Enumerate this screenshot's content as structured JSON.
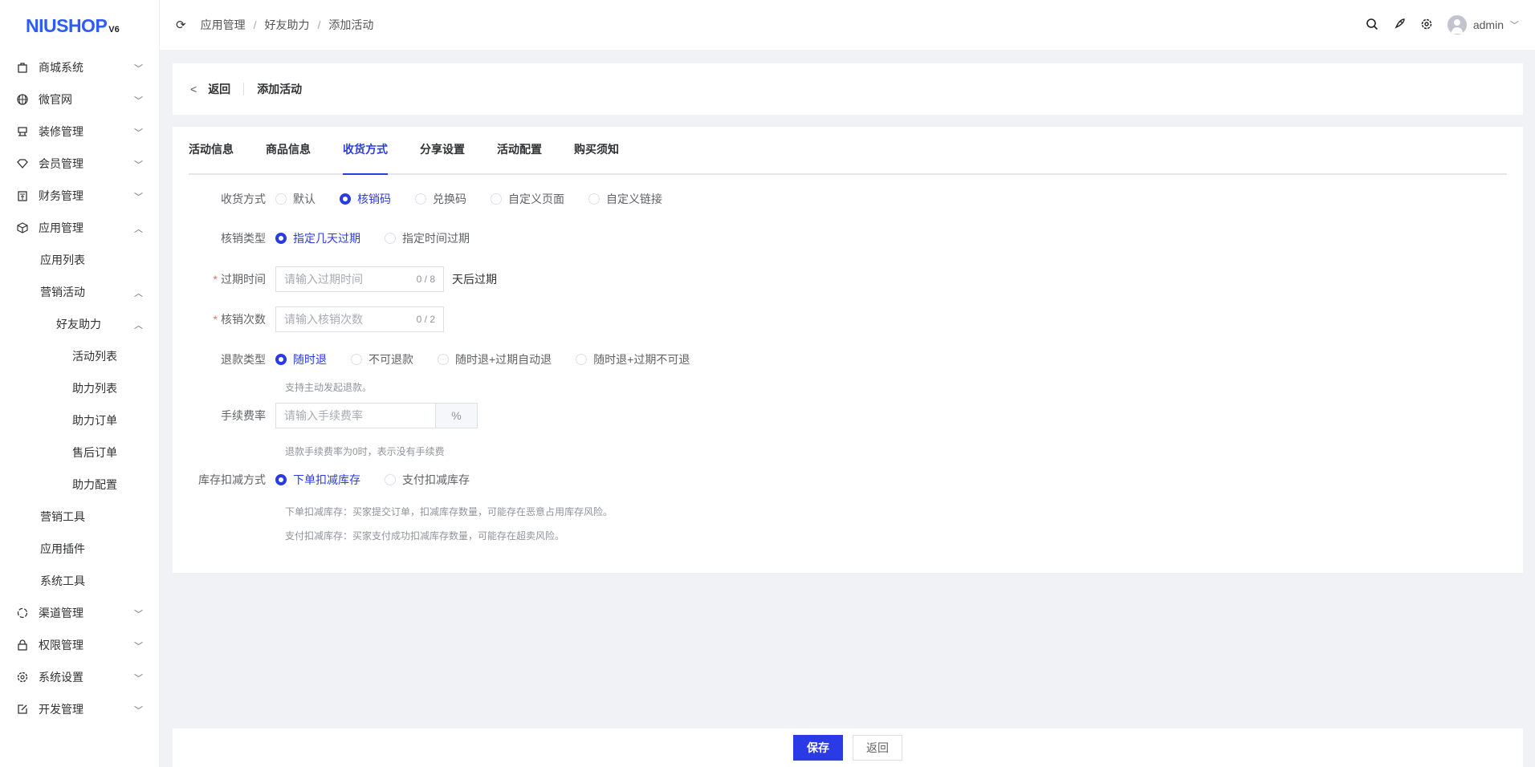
{
  "logo": {
    "text": "NIUSHOP",
    "version": "V6"
  },
  "sidebar": {
    "items": [
      {
        "label": "商城系统",
        "icon": "bag-icon",
        "level": 1,
        "expanded": false
      },
      {
        "label": "微官网",
        "icon": "globe-icon",
        "level": 1,
        "expanded": false
      },
      {
        "label": "装修管理",
        "icon": "decor-icon",
        "level": 1,
        "expanded": false
      },
      {
        "label": "会员管理",
        "icon": "diamond-icon",
        "level": 1,
        "expanded": false
      },
      {
        "label": "财务管理",
        "icon": "finance-icon",
        "level": 1,
        "expanded": false
      },
      {
        "label": "应用管理",
        "icon": "cube-icon",
        "level": 1,
        "expanded": true
      },
      {
        "label": "应用列表",
        "level": 2
      },
      {
        "label": "营销活动",
        "level": 2,
        "expanded": true
      },
      {
        "label": "好友助力",
        "level": 3,
        "expanded": true
      },
      {
        "label": "活动列表",
        "level": 4
      },
      {
        "label": "助力列表",
        "level": 4
      },
      {
        "label": "助力订单",
        "level": 4
      },
      {
        "label": "售后订单",
        "level": 4
      },
      {
        "label": "助力配置",
        "level": 4
      },
      {
        "label": "营销工具",
        "level": 2
      },
      {
        "label": "应用插件",
        "level": 2
      },
      {
        "label": "系统工具",
        "level": 2
      },
      {
        "label": "渠道管理",
        "icon": "channel-icon",
        "level": 1,
        "expanded": false
      },
      {
        "label": "权限管理",
        "icon": "lock-icon",
        "level": 1,
        "expanded": false
      },
      {
        "label": "系统设置",
        "icon": "gear-icon",
        "level": 1,
        "expanded": false
      },
      {
        "label": "开发管理",
        "icon": "edit-icon",
        "level": 1,
        "expanded": false
      }
    ]
  },
  "header": {
    "breadcrumb": [
      "应用管理",
      "好友助力",
      "添加活动"
    ],
    "user": "admin"
  },
  "page": {
    "back": "返回",
    "title": "添加活动"
  },
  "tabs": [
    "活动信息",
    "商品信息",
    "收货方式",
    "分享设置",
    "活动配置",
    "购买须知"
  ],
  "active_tab": 2,
  "form": {
    "delivery": {
      "label": "收货方式",
      "options": [
        "默认",
        "核销码",
        "兑换码",
        "自定义页面",
        "自定义链接"
      ],
      "selected": 1
    },
    "verify_type": {
      "label": "核销类型",
      "options": [
        "指定几天过期",
        "指定时间过期"
      ],
      "selected": 0
    },
    "expire": {
      "label": "过期时间",
      "placeholder": "请输入过期时间",
      "count": "0 / 8",
      "suffix": "天后过期"
    },
    "verify_count": {
      "label": "核销次数",
      "placeholder": "请输入核销次数",
      "count": "0 / 2"
    },
    "refund_type": {
      "label": "退款类型",
      "options": [
        "随时退",
        "不可退款",
        "随时退+过期自动退",
        "随时退+过期不可退"
      ],
      "selected": 0,
      "hint": "支持主动发起退款。"
    },
    "fee": {
      "label": "手续费率",
      "placeholder": "请输入手续费率",
      "append": "%",
      "hint": "退款手续费率为0时，表示没有手续费"
    },
    "stock": {
      "label": "库存扣减方式",
      "options": [
        "下单扣减库存",
        "支付扣减库存"
      ],
      "selected": 0,
      "hint1": "下单扣减库存：买家提交订单，扣减库存数量，可能存在恶意占用库存风险。",
      "hint2": "支付扣减库存：买家支付成功扣减库存数量，可能存在超卖风险。"
    }
  },
  "footer": {
    "save": "保存",
    "back": "返回"
  },
  "colors": {
    "primary": "#2a3be6",
    "logo": "#2e5cf6"
  }
}
